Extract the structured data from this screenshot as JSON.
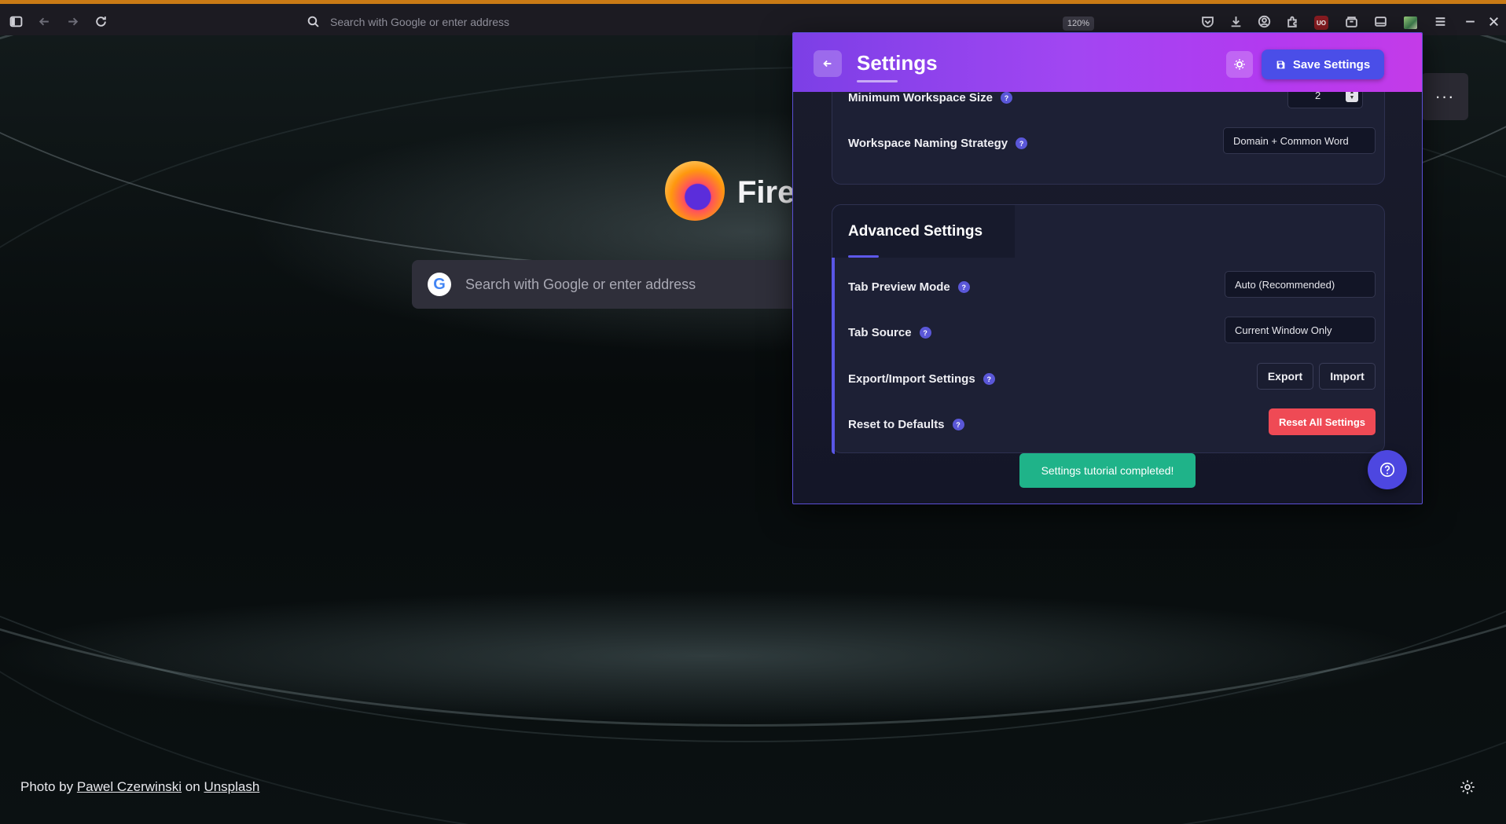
{
  "browser": {
    "address_placeholder": "Search with Google or enter address",
    "zoom": "120%",
    "ublock_badge": "UO",
    "accent_color": "#c97a15"
  },
  "newtab": {
    "brand": "Fire",
    "search_placeholder": "Search with Google or enter address",
    "google_letter": "G",
    "menu_dots": "···",
    "credit": {
      "prefix": "Photo by",
      "author": "Pawel Czerwinski",
      "middle": "on",
      "site": "Unsplash"
    }
  },
  "settings": {
    "title": "Settings",
    "save_label": "Save Settings",
    "rows_top": [
      {
        "label": "Minimum Workspace Size",
        "value": "2"
      },
      {
        "label": "Workspace Naming Strategy",
        "value": "Domain + Common Word"
      }
    ],
    "advanced": {
      "title": "Advanced Settings",
      "tab_preview_mode": {
        "label": "Tab Preview Mode",
        "value": "Auto (Recommended)"
      },
      "tab_source": {
        "label": "Tab Source",
        "value": "Current Window Only"
      },
      "export_import": {
        "label": "Export/Import Settings",
        "export": "Export",
        "import": "Import"
      },
      "reset": {
        "label": "Reset to Defaults",
        "button": "Reset All Settings"
      }
    },
    "help_glyph": "?",
    "toast": "Settings tutorial completed!",
    "colors": {
      "header_start": "#7c3fe6",
      "header_end": "#c43be8",
      "primary": "#4a4ee8",
      "danger": "#ef4a55",
      "success": "#1fb389"
    }
  }
}
